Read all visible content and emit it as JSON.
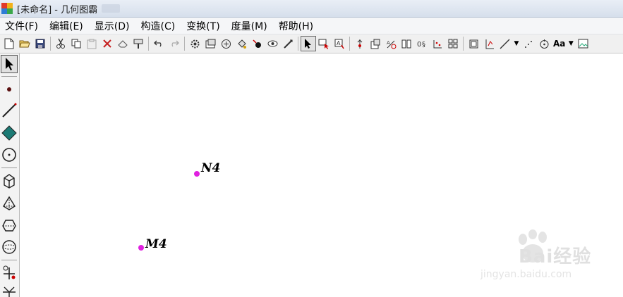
{
  "window": {
    "title": "[未命名] - 几何图霸"
  },
  "menu": {
    "items": [
      "文件(F)",
      "编辑(E)",
      "显示(D)",
      "构造(C)",
      "变换(T)",
      "度量(M)",
      "帮助(H)"
    ]
  },
  "toolbar": {
    "font_button_label": "Aa",
    "icons": [
      "new-file-icon",
      "open-folder-icon",
      "save-icon",
      "cut-icon",
      "copy-icon",
      "paste-icon",
      "delete-icon",
      "eraser-icon",
      "format-brush-icon",
      "undo-icon",
      "redo-icon",
      "settings-icon",
      "properties-icon",
      "animation-icon",
      "color-fill-icon",
      "point-color-icon",
      "show-hide-icon",
      "trace-icon",
      "selection-arrow-icon",
      "label-tool-icon",
      "text-tool-icon",
      "construct-icon",
      "measure-icon",
      "transform-icon",
      "coordinate-icon",
      "function-icon",
      "dot-grid-icon",
      "frame-icon",
      "axis-icon",
      "line-style-icon",
      "point-style-icon",
      "circle-tool-icon",
      "font-icon",
      "picture-icon"
    ]
  },
  "palette": {
    "tools": [
      "select-arrow",
      "point",
      "segment",
      "polygon",
      "circle",
      "cube",
      "pyramid",
      "prism",
      "sphere",
      "custom-tool",
      "more-tools"
    ]
  },
  "canvas": {
    "points": [
      {
        "name": "N4",
        "label": "N4"
      },
      {
        "name": "M4",
        "label": "M4"
      }
    ],
    "point_color": "#e020e0"
  },
  "watermark": {
    "brand": "Bai经验",
    "url": "jingyan.baidu.com"
  }
}
